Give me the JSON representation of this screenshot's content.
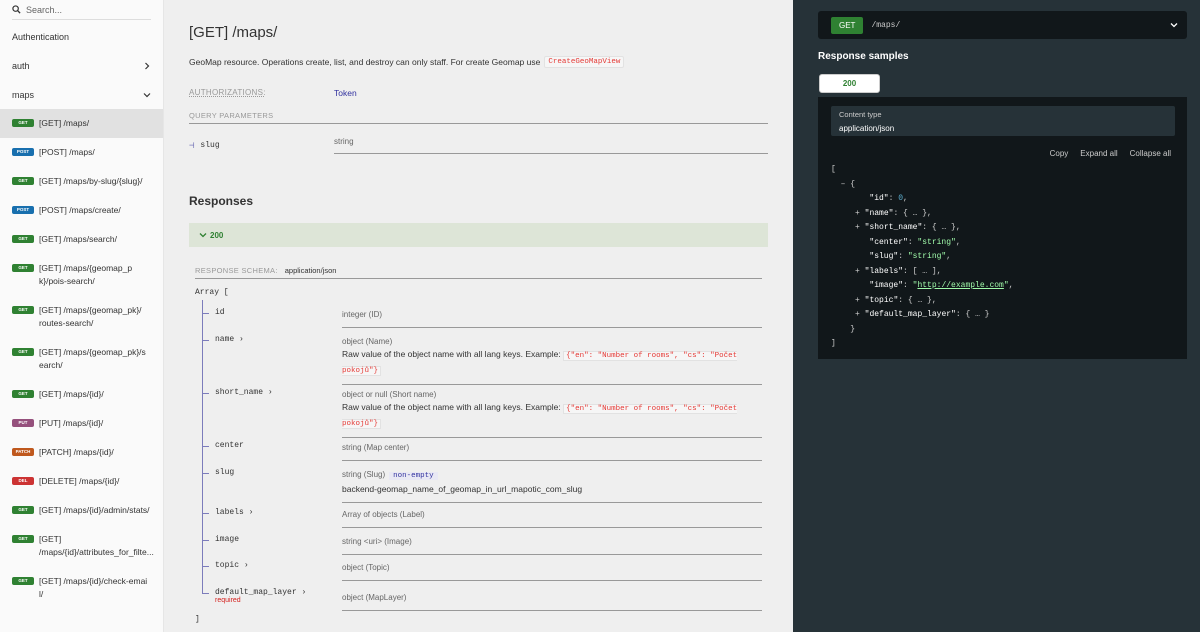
{
  "sidebar": {
    "search_placeholder": "Search...",
    "groups": [
      {
        "label": "Authentication"
      },
      {
        "label": "auth"
      },
      {
        "label": "maps"
      }
    ],
    "endpoints": [
      {
        "method": "GET",
        "label": "[GET] /maps/"
      },
      {
        "method": "POST",
        "label": "[POST] /maps/"
      },
      {
        "method": "GET",
        "label": "[GET] /maps/by-slug/{slug}/"
      },
      {
        "method": "POST",
        "label": "[POST] /maps/create/"
      },
      {
        "method": "GET",
        "label": "[GET] /maps/search/"
      },
      {
        "method": "GET",
        "label": "[GET] /maps/{geomap_pk}/pois-search/"
      },
      {
        "method": "GET",
        "label": "[GET] /maps/{geomap_pk}/routes-search/"
      },
      {
        "method": "GET",
        "label": "[GET] /maps/{geomap_pk}/search/"
      },
      {
        "method": "GET",
        "label": "[GET] /maps/{id}/"
      },
      {
        "method": "PUT",
        "label": "[PUT] /maps/{id}/"
      },
      {
        "method": "PATCH",
        "label": "[PATCH] /maps/{id}/"
      },
      {
        "method": "DEL",
        "label": "[DELETE] /maps/{id}/"
      },
      {
        "method": "GET",
        "label": "[GET] /maps/{id}/admin/stats/"
      },
      {
        "method": "GET",
        "label": "[GET] /maps/{id}/attributes_for_filte..."
      },
      {
        "method": "GET",
        "label": "[GET] /maps/{id}/check-email/"
      }
    ]
  },
  "main": {
    "title": "[GET] /maps/",
    "description": "GeoMap resource. Operations create, list, and destroy can only staff. For create Geomap use",
    "description_code": "CreateGeoMapView",
    "auth_label": "AUTHORIZATIONS:",
    "auth_value": "Token",
    "query_label": "QUERY PARAMETERS",
    "param_name": "slug",
    "param_type": "string",
    "responses_title": "Responses",
    "response_code": "200",
    "schema_label": "RESPONSE SCHEMA:",
    "schema_type": "application/json",
    "array_open": "Array [",
    "array_close": "]",
    "fields": [
      {
        "name": "id",
        "type": "integer (ID)"
      },
      {
        "name": "name",
        "type": "object (Name)",
        "example_prefix": "Raw value of the object name with all lang keys. Example:",
        "example": "{\"en\": \"Number of rooms\", \"cs\": \"Počet pokojů\"}"
      },
      {
        "name": "short_name",
        "type": "object or null (Short name)",
        "example_prefix": "Raw value of the object name with all lang keys. Example:",
        "example": "{\"en\": \"Number of rooms\", \"cs\": \"Počet pokojů\"}"
      },
      {
        "name": "center",
        "type": "string (Map center)"
      },
      {
        "name": "slug",
        "type": "string (Slug)",
        "tag": "non-empty",
        "value": "backend-geomap_name_of_geomap_in_url_mapotic_com_slug"
      },
      {
        "name": "labels",
        "type": "Array of objects (Label)"
      },
      {
        "name": "image",
        "type": "string <uri> (Image)"
      },
      {
        "name": "topic",
        "type": "object (Topic)"
      },
      {
        "name": "default_map_layer",
        "type": "object (MapLayer)",
        "required": "required"
      }
    ]
  },
  "right": {
    "method": "GET",
    "path": "/maps/",
    "samples_title": "Response samples",
    "tab": "200",
    "content_type_label": "Content type",
    "content_type_value": "application/json",
    "copy": "Copy",
    "expand_all": "Expand all",
    "collapse_all": "Collapse all",
    "json_id": "0",
    "json_center": "\"string\"",
    "json_slug": "\"string\"",
    "json_image": "http://example.com"
  },
  "colors": {
    "get": "#2f8132",
    "post": "#186fae",
    "put": "#95507c",
    "patch": "#bf581d",
    "delete": "#cc3333",
    "right_panel": "#263238"
  }
}
